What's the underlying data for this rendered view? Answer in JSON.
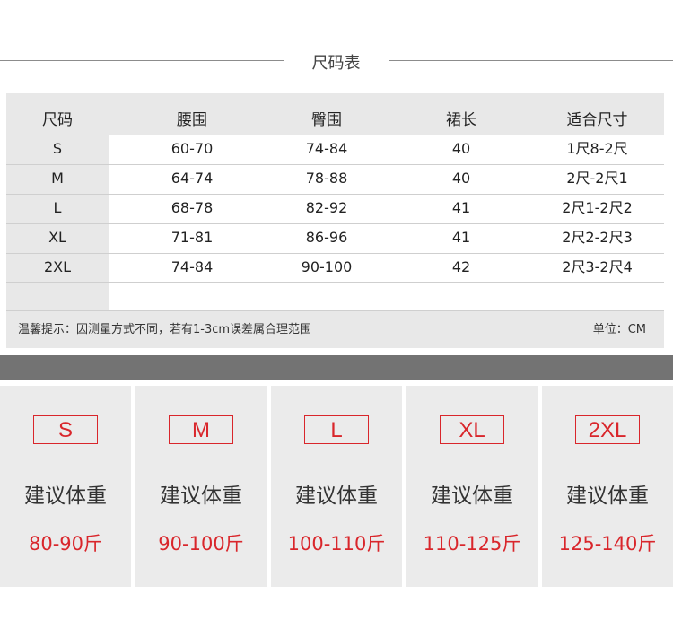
{
  "title": "尺码表",
  "table": {
    "headers": [
      "尺码",
      "腰围",
      "臀围",
      "裙长",
      "适合尺寸"
    ],
    "rows": [
      [
        "S",
        "60-70",
        "74-84",
        "40",
        "1尺8-2尺"
      ],
      [
        "M",
        "64-74",
        "78-88",
        "40",
        "2尺-2尺1"
      ],
      [
        "L",
        "68-78",
        "82-92",
        "41",
        "2尺1-2尺2"
      ],
      [
        "XL",
        "71-81",
        "86-96",
        "41",
        "2尺2-2尺3"
      ],
      [
        "2XL",
        "74-84",
        "90-100",
        "42",
        "2尺3-2尺4"
      ]
    ],
    "note": "温馨提示：因测量方式不同，若有1-3cm误差属合理范围",
    "unit": "单位：CM"
  },
  "cards": [
    {
      "size": "S",
      "label": "建议体重",
      "weight": "80-90斤"
    },
    {
      "size": "M",
      "label": "建议体重",
      "weight": "90-100斤"
    },
    {
      "size": "L",
      "label": "建议体重",
      "weight": "100-110斤"
    },
    {
      "size": "XL",
      "label": "建议体重",
      "weight": "110-125斤"
    },
    {
      "size": "2XL",
      "label": "建议体重",
      "weight": "125-140斤"
    }
  ],
  "colors": {
    "accent": "#d9262b",
    "band": "#737373",
    "card_bg": "#ebebeb",
    "table_bg": "#e8e8e8"
  }
}
